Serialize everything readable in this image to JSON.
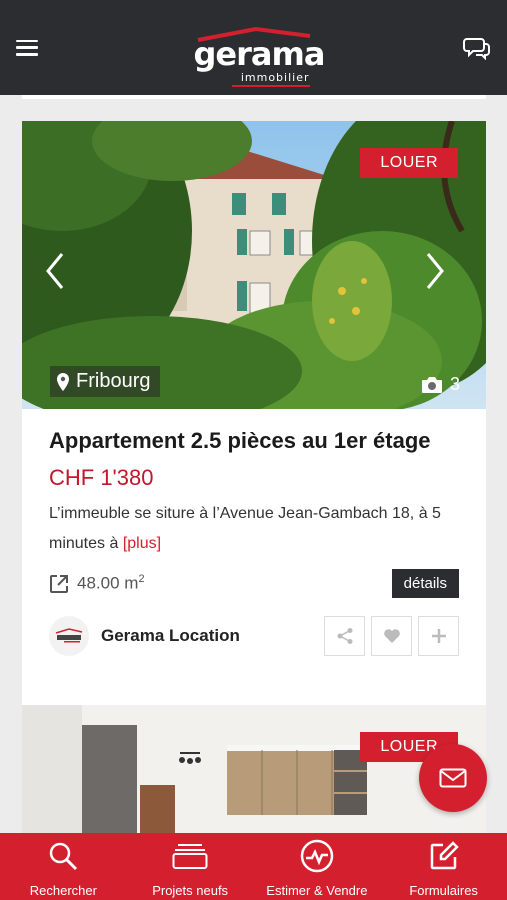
{
  "header": {
    "brand": "gerama",
    "brand_sub": "immobilier",
    "menu_icon": "hamburger-menu-icon",
    "chat_icon": "chat-bubbles-icon"
  },
  "listing": {
    "badge": "LOUER",
    "location": "Fribourg",
    "photo_count": "3",
    "title": "Appartement 2.5 pièces au 1er étage",
    "price": "CHF 1'380",
    "description": "L’immeuble se siture à l’Avenue Jean-Gambach 18, à 5 minutes à",
    "more_link": "[plus]",
    "area_value": "48.00 m",
    "area_unit_sup": "2",
    "details_label": "détails",
    "agency_name": "Gerama Location"
  },
  "listing2": {
    "badge": "LOUER"
  },
  "bottom_nav": [
    {
      "label": "Rechercher",
      "icon": "search-icon"
    },
    {
      "label": "Projets neufs",
      "icon": "stack-icon"
    },
    {
      "label": "Estimer & Vendre",
      "icon": "chart-circle-icon"
    },
    {
      "label": "Formulaires",
      "icon": "edit-form-icon"
    }
  ],
  "colors": {
    "accent": "#d4202e",
    "header_bg": "#2b2d31"
  }
}
